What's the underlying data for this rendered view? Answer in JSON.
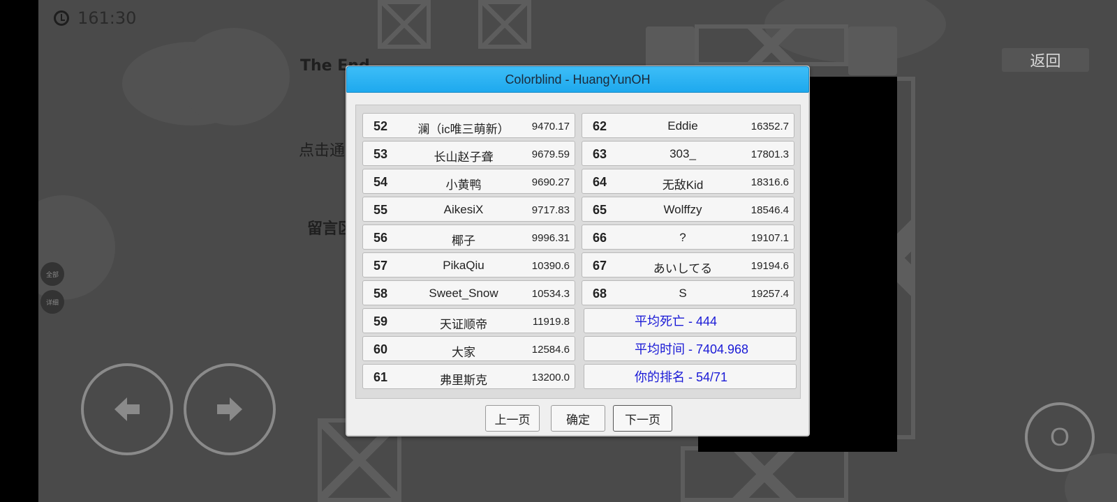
{
  "hud": {
    "timer": "161:30",
    "back_label": "返回",
    "side_btn_1": "全部",
    "side_btn_2": "详细",
    "action_label": "O"
  },
  "background": {
    "end_text": "The End",
    "hint_text": "点击通",
    "comment_text": "留言区"
  },
  "dialog": {
    "title": "Colorblind - HuangYunOH",
    "left_column": [
      {
        "rank": "52",
        "name": "澜（ic唯三萌新）",
        "score": "9470.17"
      },
      {
        "rank": "53",
        "name": "长山赵子聋",
        "score": "9679.59"
      },
      {
        "rank": "54",
        "name": "小黄鸭",
        "score": "9690.27"
      },
      {
        "rank": "55",
        "name": "AikesiX",
        "score": "9717.83"
      },
      {
        "rank": "56",
        "name": "椰子",
        "score": "9996.31"
      },
      {
        "rank": "57",
        "name": "PikaQiu",
        "score": "10390.6"
      },
      {
        "rank": "58",
        "name": "Sweet_Snow",
        "score": "10534.3"
      },
      {
        "rank": "59",
        "name": "天证顺帝",
        "score": "11919.8"
      },
      {
        "rank": "60",
        "name": "大家",
        "score": "12584.6"
      },
      {
        "rank": "61",
        "name": "弗里斯克",
        "score": "13200.0"
      }
    ],
    "right_column": [
      {
        "rank": "62",
        "name": "Eddie",
        "score": "16352.7"
      },
      {
        "rank": "63",
        "name": "303_",
        "score": "17801.3"
      },
      {
        "rank": "64",
        "name": "无敌Kid",
        "score": "18316.6"
      },
      {
        "rank": "65",
        "name": "Wolffzy",
        "score": "18546.4"
      },
      {
        "rank": "66",
        "name": "?",
        "score": "19107.1"
      },
      {
        "rank": "67",
        "name": "あいしてる",
        "score": "19194.6"
      },
      {
        "rank": "68",
        "name": "S",
        "score": "19257.4"
      }
    ],
    "stats": {
      "avg_deaths": "平均死亡 - 444",
      "avg_time": "平均时间 - 7404.968",
      "your_rank": "你的排名 - 54/71"
    },
    "buttons": {
      "prev": "上一页",
      "ok": "确定",
      "next": "下一页"
    }
  },
  "colors": {
    "title_bar": "#1ea9ee",
    "stat_text": "#1a1ad6"
  }
}
